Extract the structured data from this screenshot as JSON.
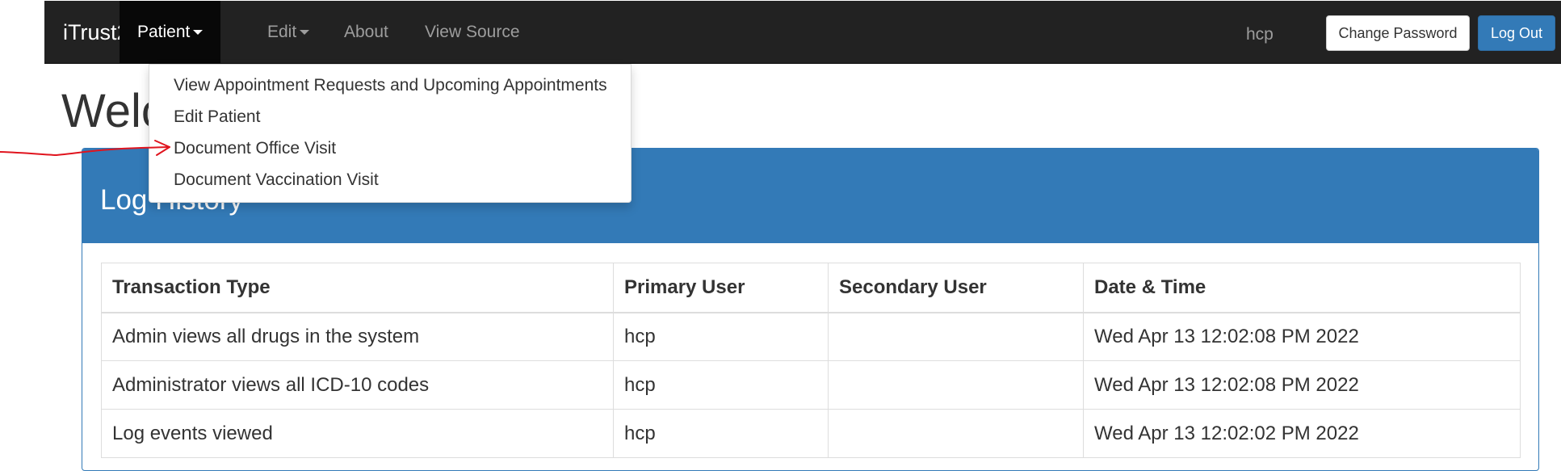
{
  "navbar": {
    "brand": "iTrust2",
    "items": [
      {
        "label": "Patient",
        "active": true,
        "dropdown": true
      },
      {
        "label": "Edit",
        "active": false,
        "dropdown": true
      },
      {
        "label": "About",
        "active": false,
        "dropdown": false
      },
      {
        "label": "View Source",
        "active": false,
        "dropdown": false
      }
    ],
    "username": "hcp",
    "change_password_label": "Change Password",
    "logout_label": "Log Out"
  },
  "page": {
    "title": "Welcome"
  },
  "patient_menu": {
    "items": [
      {
        "label": "View Appointment Requests and Upcoming Appointments"
      },
      {
        "label": "Edit Patient"
      },
      {
        "label": "Document Office Visit"
      },
      {
        "label": "Document Vaccination Visit"
      }
    ]
  },
  "log_panel": {
    "title": "Log History",
    "columns": [
      "Transaction Type",
      "Primary User",
      "Secondary User",
      "Date & Time"
    ],
    "rows": [
      {
        "transaction_type": "Admin views all drugs in the system",
        "primary_user": "hcp",
        "secondary_user": "",
        "datetime": "Wed Apr 13 12:02:08 PM 2022"
      },
      {
        "transaction_type": "Administrator views all ICD-10 codes",
        "primary_user": "hcp",
        "secondary_user": "",
        "datetime": "Wed Apr 13 12:02:08 PM 2022"
      },
      {
        "transaction_type": "Log events viewed",
        "primary_user": "hcp",
        "secondary_user": "",
        "datetime": "Wed Apr 13 12:02:02 PM 2022"
      }
    ]
  },
  "colors": {
    "navbar_bg": "#222222",
    "primary": "#337ab7",
    "annotation": "#e0141e"
  },
  "icons": {
    "caret": "caret-down-icon",
    "annotation": "arrow-right-icon"
  }
}
